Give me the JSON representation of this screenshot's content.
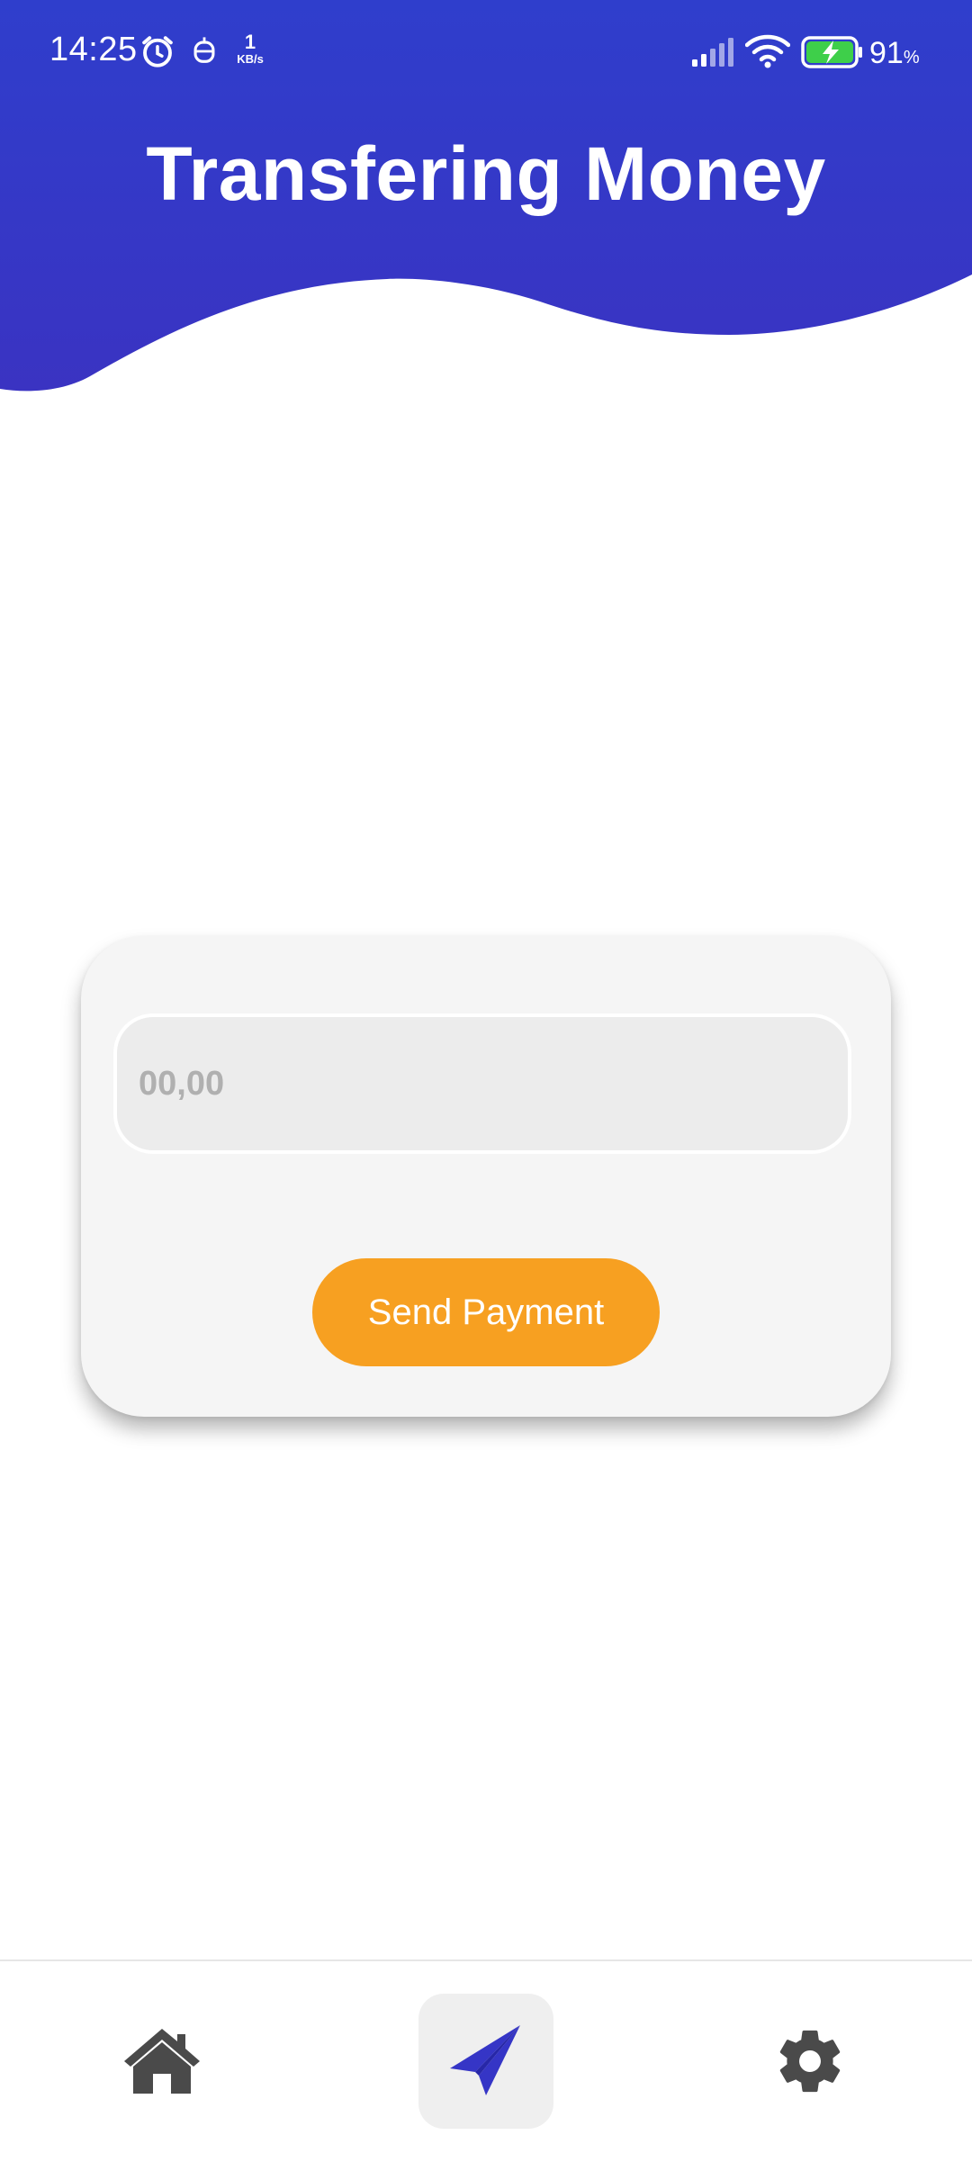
{
  "status_bar": {
    "time": "14:25",
    "net_speed_value": "1",
    "net_speed_unit": "KB/s",
    "battery_percent": "91",
    "battery_percent_sign": "%",
    "icons": [
      "alarm-icon",
      "robot-notification-icon",
      "signal-icon",
      "wifi-icon",
      "battery-charging-icon"
    ]
  },
  "header": {
    "title": "Transfering Money",
    "background_color": "#3535c6"
  },
  "transfer_card": {
    "amount_placeholder": "00,00",
    "amount_value": "",
    "send_button_label": "Send Payment",
    "send_button_color": "#f7a021"
  },
  "bottom_nav": {
    "items": [
      {
        "name": "home",
        "icon": "home-icon",
        "active": false
      },
      {
        "name": "send",
        "icon": "paper-plane-icon",
        "active": true
      },
      {
        "name": "settings",
        "icon": "gear-icon",
        "active": false
      }
    ],
    "active_color": "#3535c6",
    "inactive_color": "#4a4a4a"
  }
}
